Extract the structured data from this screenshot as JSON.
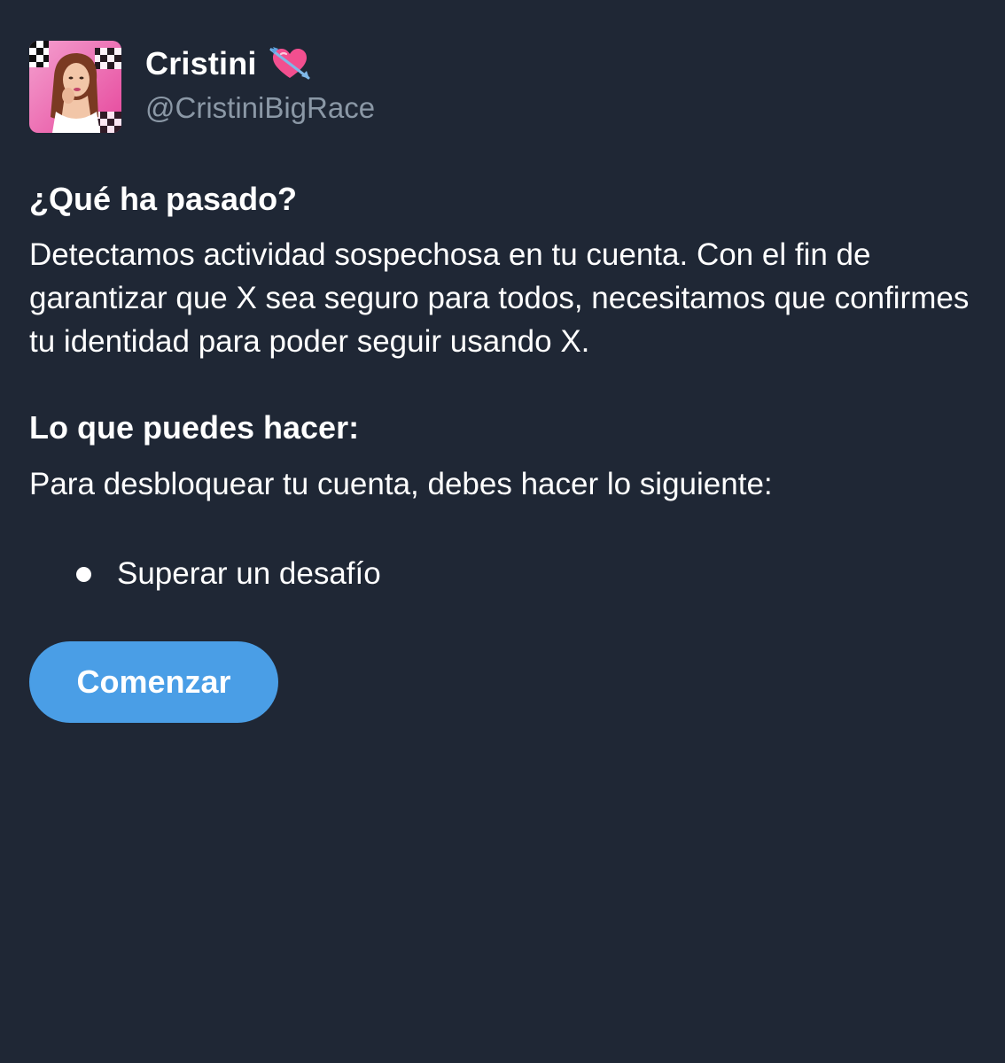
{
  "profile": {
    "display_name": "Cristini",
    "emoji_icon": "heart-with-arrow-icon",
    "handle": "@CristiniBigRace"
  },
  "what_happened": {
    "title": "¿Qué ha pasado?",
    "body": "Detectamos actividad sospechosa en tu cuenta. Con el fin de garantizar que X sea seguro para todos, necesitamos que confirmes tu identidad para poder seguir usando X."
  },
  "what_you_can_do": {
    "title": "Lo que puedes hacer:",
    "body": "Para desbloquear tu cuenta, debes hacer lo siguiente:",
    "steps": [
      {
        "label": "Superar un desafío"
      }
    ]
  },
  "actions": {
    "start_label": "Comenzar"
  },
  "colors": {
    "background": "#1f2735",
    "button": "#4a9ee6",
    "secondary_text": "#8b98a6"
  }
}
